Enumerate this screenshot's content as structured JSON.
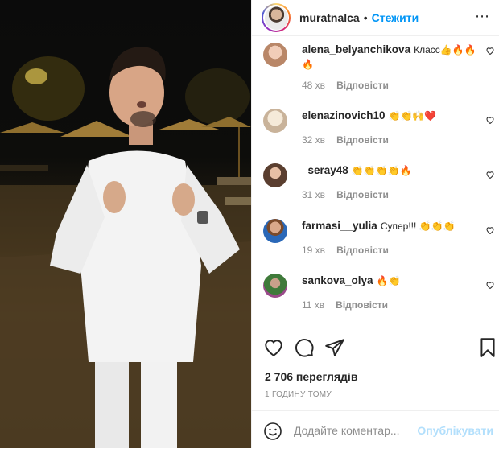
{
  "header": {
    "username": "muratnalca",
    "separator": "•",
    "follow_label": "Стежити",
    "more_icon": "⋯"
  },
  "comments": [
    {
      "user": "alena_belyanchikova",
      "text": "Класс👍🔥🔥🔥",
      "time": "48 хв",
      "reply": "Відповісти",
      "avatar_color": "#e3b7a2"
    },
    {
      "user": "elenazinovich10",
      "text": "👏👏🙌❤️",
      "time": "32 хв",
      "reply": "Відповісти",
      "avatar_color": "#e8dccf"
    },
    {
      "user": "_seray48",
      "text": "👏👏👏👏🔥",
      "time": "31 хв",
      "reply": "Відповісти",
      "avatar_color": "#7a5a48"
    },
    {
      "user": "farmasi__yulia",
      "text": "Супер!!! 👏👏👏",
      "time": "19 хв",
      "reply": "Відповісти",
      "avatar_color": "#2a68b8"
    },
    {
      "user": "sankova_olya",
      "text": "🔥👏",
      "time": "11 хв",
      "reply": "Відповісти",
      "avatar_color": "#3f7a3a"
    }
  ],
  "stats": {
    "views": "2 706 переглядів",
    "posted": "1 ГОДИНУ ТОМУ"
  },
  "add_comment": {
    "placeholder": "Додайте коментар...",
    "publish_label": "Опублікувати"
  },
  "colors": {
    "link_blue": "#0095f6",
    "publish_disabled": "#b2dffc",
    "muted": "#8e8e8e"
  }
}
